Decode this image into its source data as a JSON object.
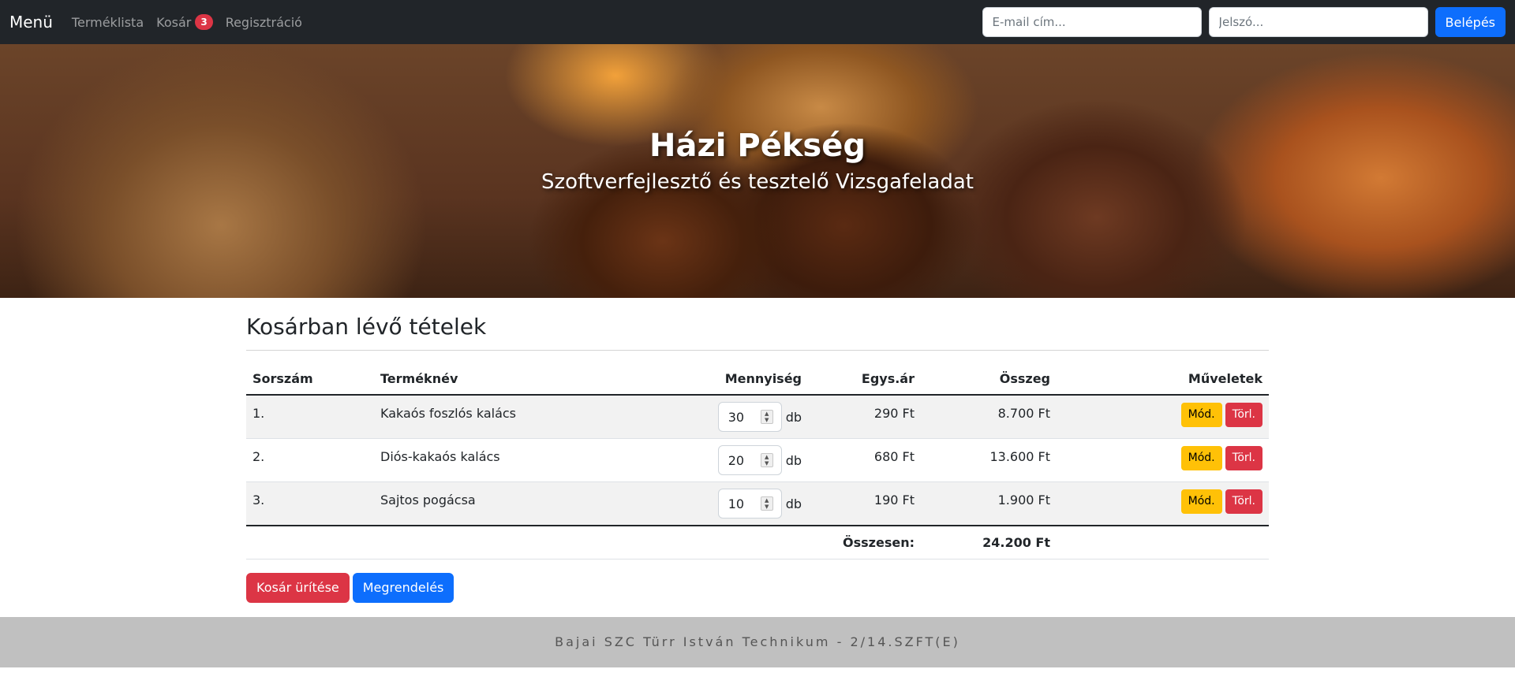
{
  "navbar": {
    "brand": "Menü",
    "links": [
      {
        "label": "Terméklista"
      },
      {
        "label": "Kosár",
        "badge": "3"
      },
      {
        "label": "Regisztráció"
      }
    ],
    "email_placeholder": "E-mail cím...",
    "password_placeholder": "Jelszó...",
    "login_label": "Belépés"
  },
  "hero": {
    "title": "Házi Pékség",
    "subtitle": "Szoftverfejlesztő és tesztelő Vizsgafeladat"
  },
  "cart": {
    "heading": "Kosárban lévő tételek",
    "columns": {
      "index": "Sorszám",
      "name": "Terméknév",
      "qty": "Mennyiség",
      "unit_price": "Egys.ár",
      "total": "Összeg",
      "actions": "Műveletek"
    },
    "rows": [
      {
        "index": "1.",
        "name": "Kakaós foszlós kalács",
        "qty": "30",
        "unit": "db",
        "unit_price": "290 Ft",
        "total": "8.700 Ft",
        "edit": "Mód.",
        "delete": "Törl."
      },
      {
        "index": "2.",
        "name": "Diós-kakaós kalács",
        "qty": "20",
        "unit": "db",
        "unit_price": "680 Ft",
        "total": "13.600 Ft",
        "edit": "Mód.",
        "delete": "Törl."
      },
      {
        "index": "3.",
        "name": "Sajtos pogácsa",
        "qty": "10",
        "unit": "db",
        "unit_price": "190 Ft",
        "total": "1.900 Ft",
        "edit": "Mód.",
        "delete": "Törl."
      }
    ],
    "sum_label": "Összesen:",
    "sum_value": "24.200 Ft",
    "empty_cart_label": "Kosár ürítése",
    "order_label": "Megrendelés"
  },
  "footer": {
    "text": "Bajai SZC Türr István Technikum - 2/14.SZFT(E)"
  },
  "colors": {
    "navbar_bg": "#212529",
    "primary": "#0d6efd",
    "danger": "#dc3545",
    "warning": "#ffc107",
    "footer_bg": "#c0c0c0"
  }
}
